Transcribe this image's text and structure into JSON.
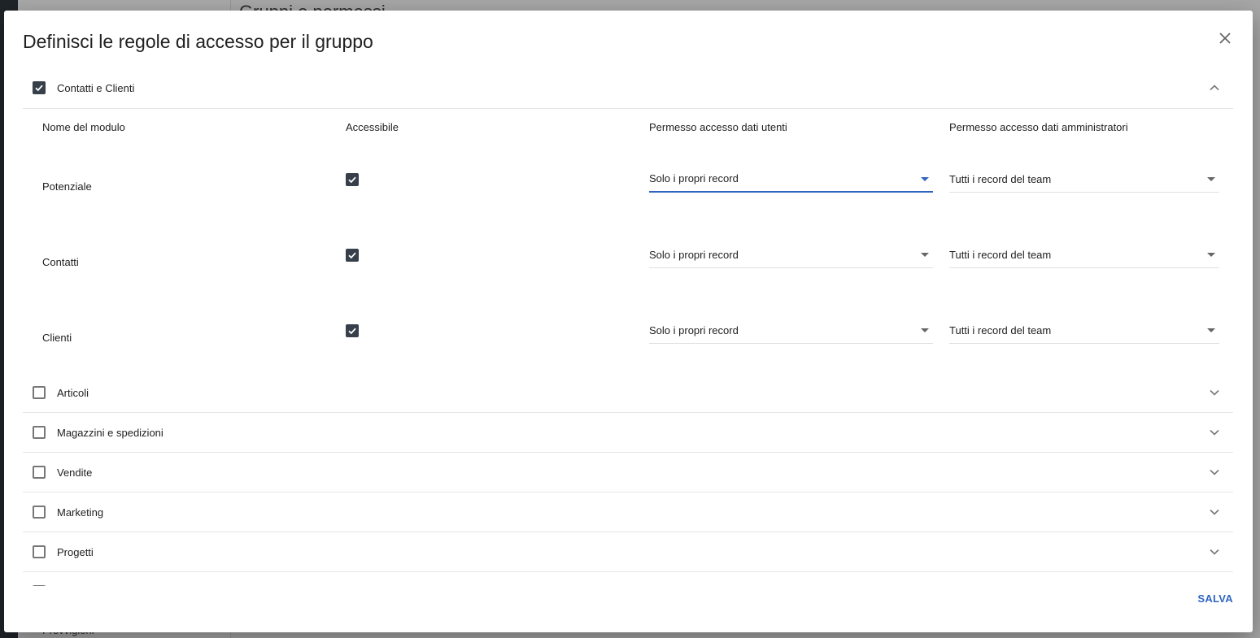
{
  "background": {
    "header_text": "Gruppi e permessi",
    "footer_text": "Provvigioni"
  },
  "dialog": {
    "title": "Definisci le regole di accesso per il gruppo",
    "save_label": "SALVA"
  },
  "expanded_section": {
    "label": "Contatti e Clienti",
    "checked": true,
    "columns": [
      "Nome del modulo",
      "Accessibile",
      "Permesso accesso dati utenti",
      "Permesso accesso dati amministratori"
    ],
    "rows": [
      {
        "module": "Potenziale",
        "accessible": true,
        "user_access": "Solo i propri record",
        "admin_access": "Tutti i record del team"
      },
      {
        "module": "Contatti",
        "accessible": true,
        "user_access": "Solo i propri record",
        "admin_access": "Tutti i record del team"
      },
      {
        "module": "Clienti",
        "accessible": true,
        "user_access": "Solo i propri record",
        "admin_access": "Tutti i record del team"
      }
    ]
  },
  "collapsed_sections": [
    {
      "label": "Articoli",
      "checked": false
    },
    {
      "label": "Magazzini e spedizioni",
      "checked": false
    },
    {
      "label": "Vendite",
      "checked": false
    },
    {
      "label": "Marketing",
      "checked": false
    },
    {
      "label": "Progetti",
      "checked": false
    }
  ],
  "colors": {
    "accent": "#2f65c0",
    "checkbox_checked": "#37404a"
  },
  "icons": {
    "close": "close-icon",
    "expand": "chevron-down-icon",
    "collapse": "chevron-up-icon",
    "check": "check-icon"
  }
}
